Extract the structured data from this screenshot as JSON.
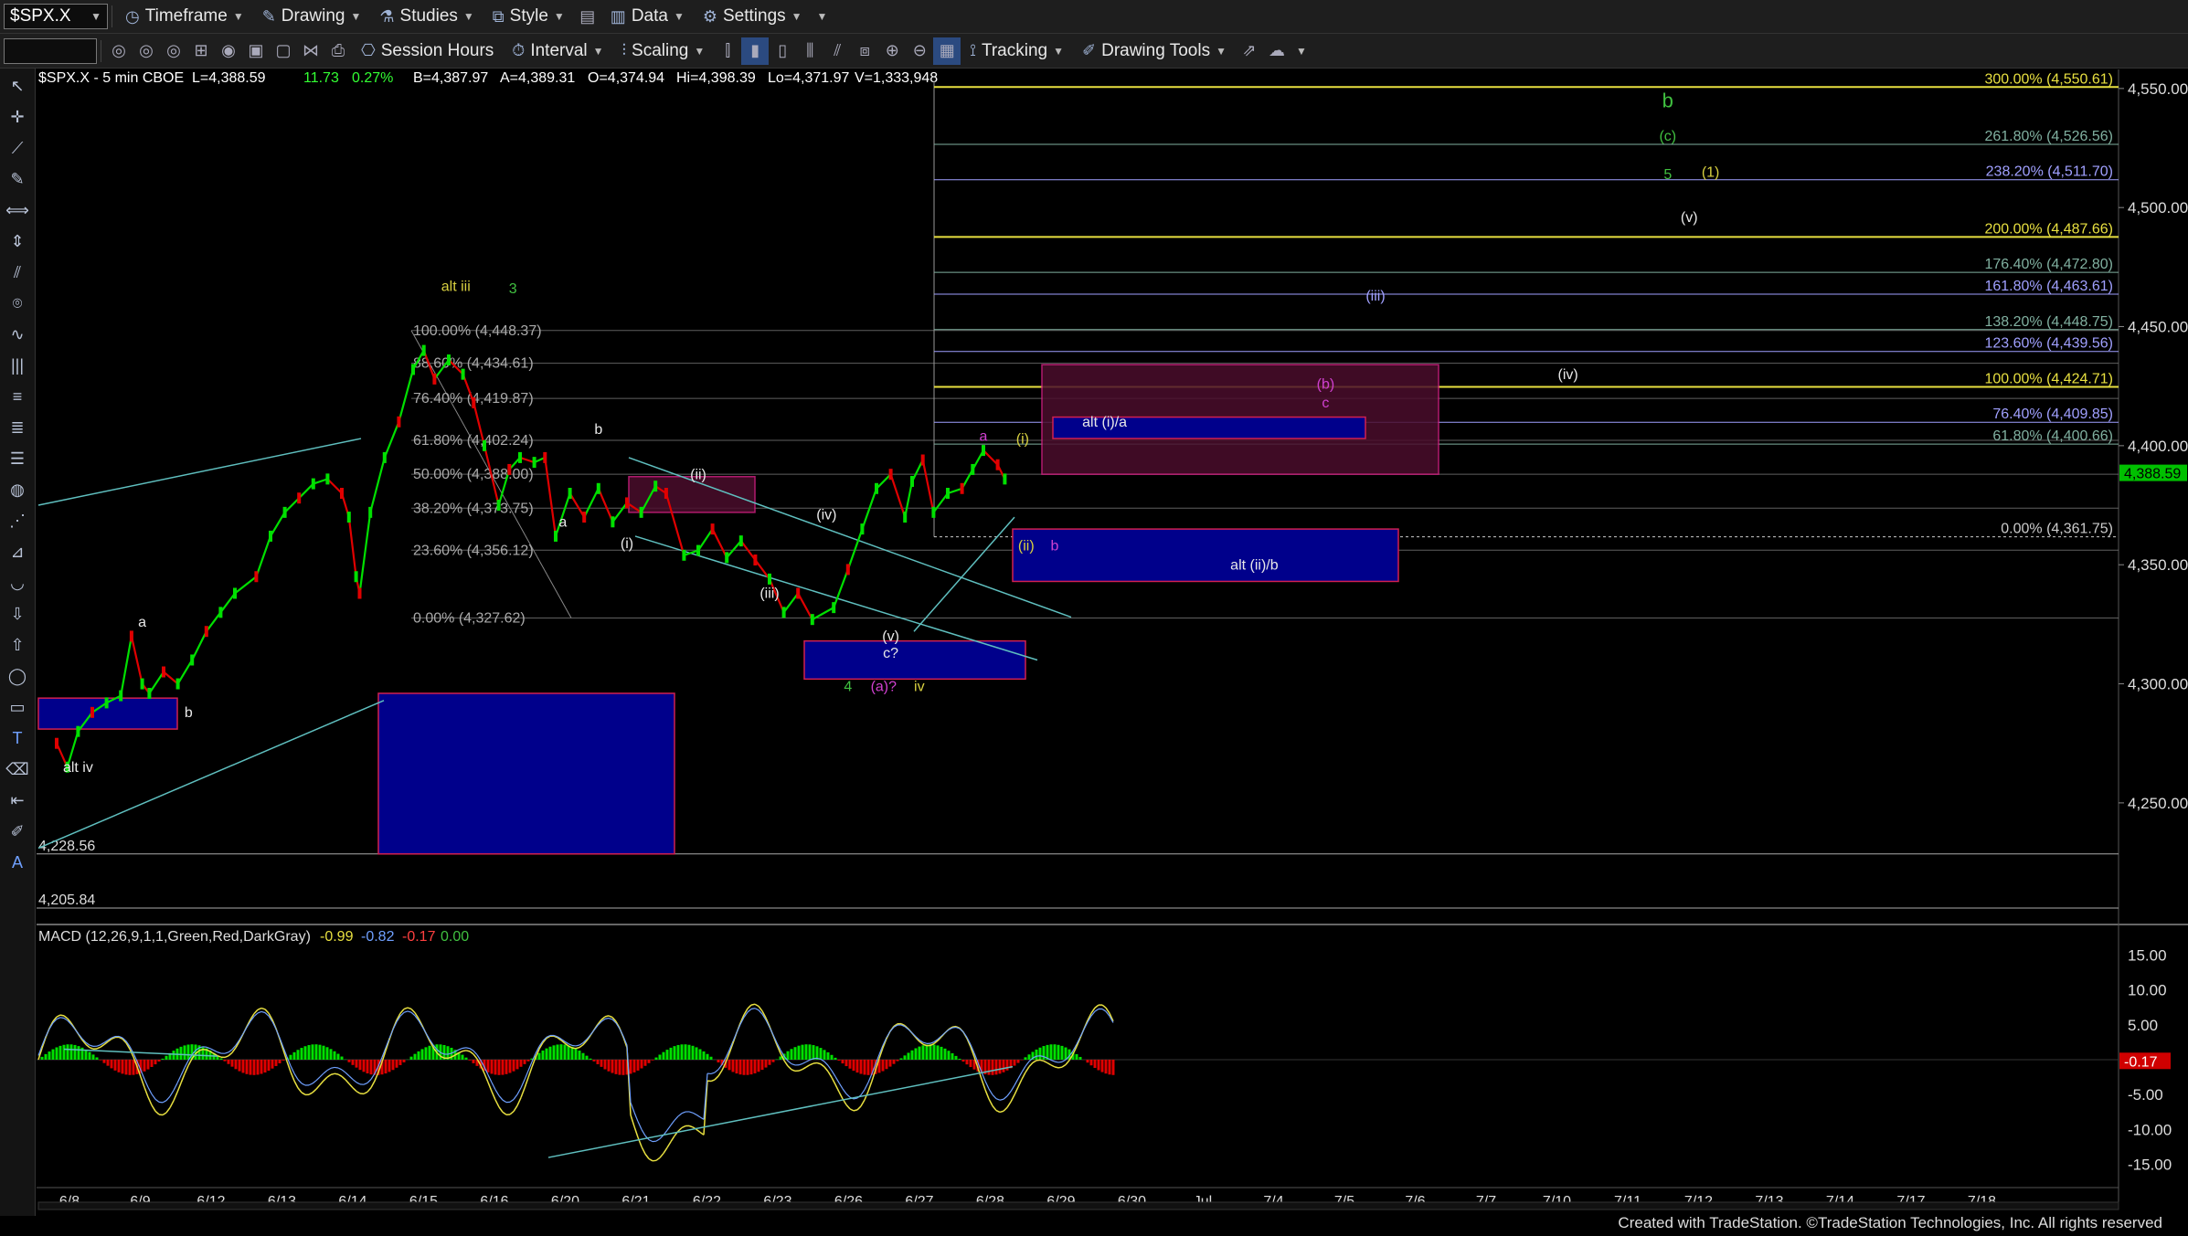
{
  "toolbar": {
    "symbol": "$SPX.X",
    "timeframe": "Timeframe",
    "drawing": "Drawing",
    "studies": "Studies",
    "style": "Style",
    "data": "Data",
    "settings": "Settings",
    "session_hours": "Session Hours",
    "interval": "Interval",
    "scaling": "Scaling",
    "tracking": "Tracking",
    "drawing_tools": "Drawing Tools"
  },
  "header": {
    "symbol_info": "$SPX.X - 5 min  CBOE",
    "last": "L=4,388.59",
    "change": "11.73",
    "change_pct": "0.27%",
    "bid": "B=4,387.97",
    "ask": "A=4,389.31",
    "open": "O=4,374.94",
    "high": "Hi=4,398.39",
    "low": "Lo=4,371.97",
    "volume": "V=1,333,948"
  },
  "macd": {
    "label": "MACD (12,26,9,1,1,Green,Red,DarkGray)",
    "v1": "-0.99",
    "v2": "-0.82",
    "v3": "-0.17",
    "v4": "0.00",
    "last_tag": "-0.17"
  },
  "footer": "Created with TradeStation. ©TradeStation Technologies, Inc. All rights reserved",
  "colors": {
    "up": "#00e000",
    "down": "#e00000",
    "fib_left": "#9a9a9a",
    "fib_yellow": "#e8e040",
    "fib_purple": "#a0a0ff",
    "fib_teal": "#80b0a0",
    "box_blue": "#00008b",
    "box_maroon": "#5a1030",
    "channel": "#5fbfbf",
    "label_green": "#40c040",
    "label_yellow": "#d8d040",
    "label_magenta": "#d040d0"
  },
  "chart_data": {
    "type": "line",
    "title": "$SPX.X - 5 min",
    "ylim": [
      4205.84,
      4550
    ],
    "y_ticks": [
      "4,550.00",
      "4,500.00",
      "4,450.00",
      "4,400.00",
      "4,350.00",
      "4,300.00",
      "4,250.00"
    ],
    "last_price_tag": "4,388.59",
    "x_ticks": [
      "6/8",
      "6/9",
      "6/12",
      "6/13",
      "6/14",
      "6/15",
      "6/16",
      "6/20",
      "6/21",
      "6/22",
      "6/23",
      "6/26",
      "6/27",
      "6/28",
      "6/29",
      "6/30",
      "Jul",
      "7/4",
      "7/5",
      "7/6",
      "7/7",
      "7/10",
      "7/11",
      "7/12",
      "7/13",
      "7/14",
      "7/17",
      "7/18"
    ],
    "series": [
      {
        "values": [
          [
            0,
            4275
          ],
          [
            0.15,
            4265
          ],
          [
            0.3,
            4280
          ],
          [
            0.5,
            4288
          ],
          [
            0.7,
            4292
          ],
          [
            0.9,
            4295
          ],
          [
            1.05,
            4320
          ],
          [
            1.2,
            4300
          ],
          [
            1.3,
            4296
          ],
          [
            1.5,
            4305
          ],
          [
            1.7,
            4300
          ],
          [
            1.9,
            4310
          ],
          [
            2.1,
            4322
          ],
          [
            2.3,
            4330
          ],
          [
            2.5,
            4338
          ],
          [
            2.8,
            4345
          ],
          [
            3.0,
            4362
          ],
          [
            3.2,
            4372
          ],
          [
            3.4,
            4378
          ],
          [
            3.6,
            4384
          ],
          [
            3.8,
            4386
          ],
          [
            4.0,
            4380
          ],
          [
            4.1,
            4370
          ],
          [
            4.2,
            4345
          ],
          [
            4.25,
            4338
          ],
          [
            4.4,
            4372
          ],
          [
            4.6,
            4395
          ],
          [
            4.8,
            4410
          ],
          [
            5.0,
            4432
          ],
          [
            5.15,
            4440
          ],
          [
            5.3,
            4428
          ],
          [
            5.5,
            4436
          ],
          [
            5.7,
            4430
          ],
          [
            5.85,
            4418
          ],
          [
            6.0,
            4400
          ],
          [
            6.2,
            4375
          ],
          [
            6.35,
            4390
          ],
          [
            6.5,
            4395
          ],
          [
            6.7,
            4393
          ],
          [
            6.85,
            4395
          ],
          [
            7.0,
            4362
          ],
          [
            7.2,
            4380
          ],
          [
            7.4,
            4370
          ],
          [
            7.6,
            4382
          ],
          [
            7.8,
            4368
          ],
          [
            8.0,
            4376
          ],
          [
            8.2,
            4372
          ],
          [
            8.4,
            4383
          ],
          [
            8.55,
            4380
          ],
          [
            8.8,
            4354
          ],
          [
            9.0,
            4356
          ],
          [
            9.2,
            4365
          ],
          [
            9.4,
            4353
          ],
          [
            9.6,
            4360
          ],
          [
            9.8,
            4352
          ],
          [
            10.0,
            4344
          ],
          [
            10.2,
            4330
          ],
          [
            10.4,
            4338
          ],
          [
            10.6,
            4327
          ],
          [
            10.9,
            4332
          ],
          [
            11.1,
            4348
          ],
          [
            11.3,
            4365
          ],
          [
            11.5,
            4382
          ],
          [
            11.7,
            4388
          ],
          [
            11.9,
            4370
          ],
          [
            12.0,
            4385
          ],
          [
            12.15,
            4394
          ],
          [
            12.3,
            4372
          ],
          [
            12.5,
            4380
          ],
          [
            12.7,
            4382
          ],
          [
            12.85,
            4390
          ],
          [
            13.0,
            4398
          ],
          [
            13.2,
            4392
          ],
          [
            13.3,
            4386
          ]
        ]
      }
    ],
    "fib_levels_left": [
      {
        "label": "100.00% (4,448.37)",
        "value": 4448.37
      },
      {
        "label": "88.60% (4,434.61)",
        "value": 4434.61
      },
      {
        "label": "76.40% (4,419.87)",
        "value": 4419.87
      },
      {
        "label": "61.80% (4,402.24)",
        "value": 4402.24
      },
      {
        "label": "50.00% (4,388.00)",
        "value": 4388.0
      },
      {
        "label": "38.20% (4,373.75)",
        "value": 4373.75
      },
      {
        "label": "23.60% (4,356.12)",
        "value": 4356.12
      },
      {
        "label": "0.00% (4,327.62)",
        "value": 4327.62
      }
    ],
    "fib_levels_right": [
      {
        "label": "300.00% (4,550.61)",
        "value": 4550.61,
        "color": "yellow"
      },
      {
        "label": "261.80% (4,526.56)",
        "value": 4526.56,
        "color": "teal"
      },
      {
        "label": "238.20% (4,511.70)",
        "value": 4511.7,
        "color": "purple"
      },
      {
        "label": "200.00% (4,487.66)",
        "value": 4487.66,
        "color": "yellow"
      },
      {
        "label": "176.40% (4,472.80)",
        "value": 4472.8,
        "color": "teal"
      },
      {
        "label": "161.80% (4,463.61)",
        "value": 4463.61,
        "color": "purple"
      },
      {
        "label": "138.20% (4,448.75)",
        "value": 4448.75,
        "color": "teal"
      },
      {
        "label": "123.60% (4,439.56)",
        "value": 4439.56,
        "color": "purple"
      },
      {
        "label": "100.00% (4,424.71)",
        "value": 4424.71,
        "color": "yellow"
      },
      {
        "label": "76.40% (4,409.85)",
        "value": 4409.85,
        "color": "purple"
      },
      {
        "label": "61.80% (4,400.66)",
        "value": 4400.66,
        "color": "teal"
      },
      {
        "label": "0.00% (4,361.75)",
        "value": 4361.75,
        "color": "white"
      }
    ],
    "horizontal_levels": [
      {
        "label": "4,228.56",
        "value": 4228.56
      },
      {
        "label": "4,205.84",
        "value": 4205.84
      }
    ],
    "wave_labels": [
      {
        "text": "b",
        "x": 22.6,
        "y": 4542,
        "color": "green"
      },
      {
        "text": "(c)",
        "x": 22.6,
        "y": 4528,
        "color": "green"
      },
      {
        "text": "5",
        "x": 22.6,
        "y": 4512,
        "color": "green"
      },
      {
        "text": "(1)",
        "x": 23.2,
        "y": 4513,
        "color": "yellow"
      },
      {
        "text": "(v)",
        "x": 22.9,
        "y": 4494,
        "color": "white"
      },
      {
        "text": "(iii)",
        "x": 18.5,
        "y": 4461,
        "color": "purple"
      },
      {
        "text": "(iv)",
        "x": 21.2,
        "y": 4428,
        "color": "white"
      },
      {
        "text": "(b)",
        "x": 17.8,
        "y": 4424,
        "color": "magenta"
      },
      {
        "text": "c",
        "x": 17.8,
        "y": 4416,
        "color": "magenta"
      },
      {
        "text": "alt (i)/a",
        "x": 14.7,
        "y": 4408,
        "color": "white"
      },
      {
        "text": "alt (ii)/b",
        "x": 16.8,
        "y": 4348,
        "color": "white"
      },
      {
        "text": "a",
        "x": 13.0,
        "y": 4402,
        "color": "magenta"
      },
      {
        "text": "(i)",
        "x": 13.55,
        "y": 4401,
        "color": "yellow"
      },
      {
        "text": "(ii)",
        "x": 13.6,
        "y": 4356,
        "color": "yellow"
      },
      {
        "text": "b",
        "x": 14.0,
        "y": 4356,
        "color": "magenta"
      },
      {
        "text": "alt iii",
        "x": 5.6,
        "y": 4465,
        "color": "yellow"
      },
      {
        "text": "3",
        "x": 6.4,
        "y": 4464,
        "color": "green"
      },
      {
        "text": "b",
        "x": 7.6,
        "y": 4405,
        "color": "white"
      },
      {
        "text": "a",
        "x": 7.1,
        "y": 4366,
        "color": "white"
      },
      {
        "text": "(i)",
        "x": 8.0,
        "y": 4357,
        "color": "white"
      },
      {
        "text": "(ii)",
        "x": 9.0,
        "y": 4386,
        "color": "white"
      },
      {
        "text": "(iv)",
        "x": 10.8,
        "y": 4369,
        "color": "white"
      },
      {
        "text": "(iii)",
        "x": 10.0,
        "y": 4336,
        "color": "white"
      },
      {
        "text": "(v)",
        "x": 11.7,
        "y": 4318,
        "color": "white"
      },
      {
        "text": "c?",
        "x": 11.7,
        "y": 4311,
        "color": "white"
      },
      {
        "text": "4",
        "x": 11.1,
        "y": 4297,
        "color": "green"
      },
      {
        "text": "(a)?",
        "x": 11.6,
        "y": 4297,
        "color": "magenta"
      },
      {
        "text": "iv",
        "x": 12.1,
        "y": 4297,
        "color": "yellow"
      },
      {
        "text": "a",
        "x": 1.2,
        "y": 4324,
        "color": "white"
      },
      {
        "text": "b",
        "x": 1.85,
        "y": 4286,
        "color": "white"
      },
      {
        "text": "alt iv",
        "x": 0.3,
        "y": 4263,
        "color": "white"
      }
    ],
    "macd_y_ticks": [
      "15.00",
      "10.00",
      "5.00",
      "-5.00",
      "-10.00",
      "-15.00"
    ],
    "macd_ylim": [
      -17,
      17
    ]
  }
}
